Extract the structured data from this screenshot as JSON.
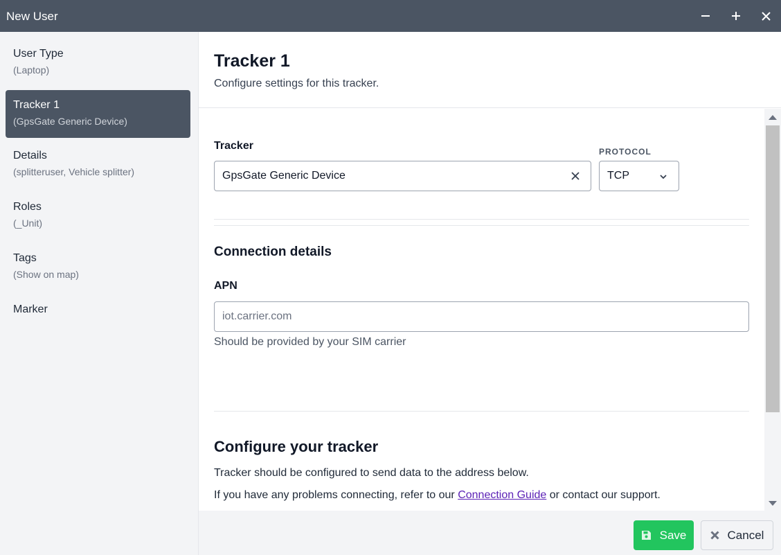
{
  "window": {
    "title": "New User"
  },
  "sidebar": {
    "items": [
      {
        "label": "User Type",
        "sub": "(Laptop)"
      },
      {
        "label": "Tracker 1",
        "sub": "(GpsGate Generic Device)"
      },
      {
        "label": "Details",
        "sub": "(splitteruser, Vehicle splitter)"
      },
      {
        "label": "Roles",
        "sub": "(_Unit)"
      },
      {
        "label": "Tags",
        "sub": "(Show on map)"
      },
      {
        "label": "Marker",
        "sub": ""
      }
    ],
    "active_index": 1
  },
  "header": {
    "title": "Tracker 1",
    "subtitle": "Configure settings for this tracker."
  },
  "tracker": {
    "label": "Tracker",
    "value": "GpsGate Generic Device",
    "protocol_label": "PROTOCOL",
    "protocol_value": "TCP"
  },
  "connection": {
    "title": "Connection details",
    "apn_label": "APN",
    "apn_value": "",
    "apn_placeholder": "iot.carrier.com",
    "apn_hint": "Should be provided by your SIM carrier"
  },
  "configure": {
    "title": "Configure your tracker",
    "line1": "Tracker should be configured to send data to the address below.",
    "line2_before": "If you have any problems connecting, refer to our",
    "line2_link": "Connection Guide",
    "line2_after": "or contact our support."
  },
  "footer": {
    "save_label": "Save",
    "cancel_label": "Cancel"
  },
  "colors": {
    "titlebar": "#4b5563",
    "sidebar_active": "#4b5563",
    "save_button": "#22c55e",
    "link": "#5b21b6"
  },
  "icons": {
    "minimize": "minimize-icon",
    "maximize": "maximize-icon",
    "close": "close-icon",
    "clear": "clear-icon",
    "dropdown": "chevron-down-icon",
    "save": "floppy-disk-icon",
    "cancel": "x-icon"
  }
}
